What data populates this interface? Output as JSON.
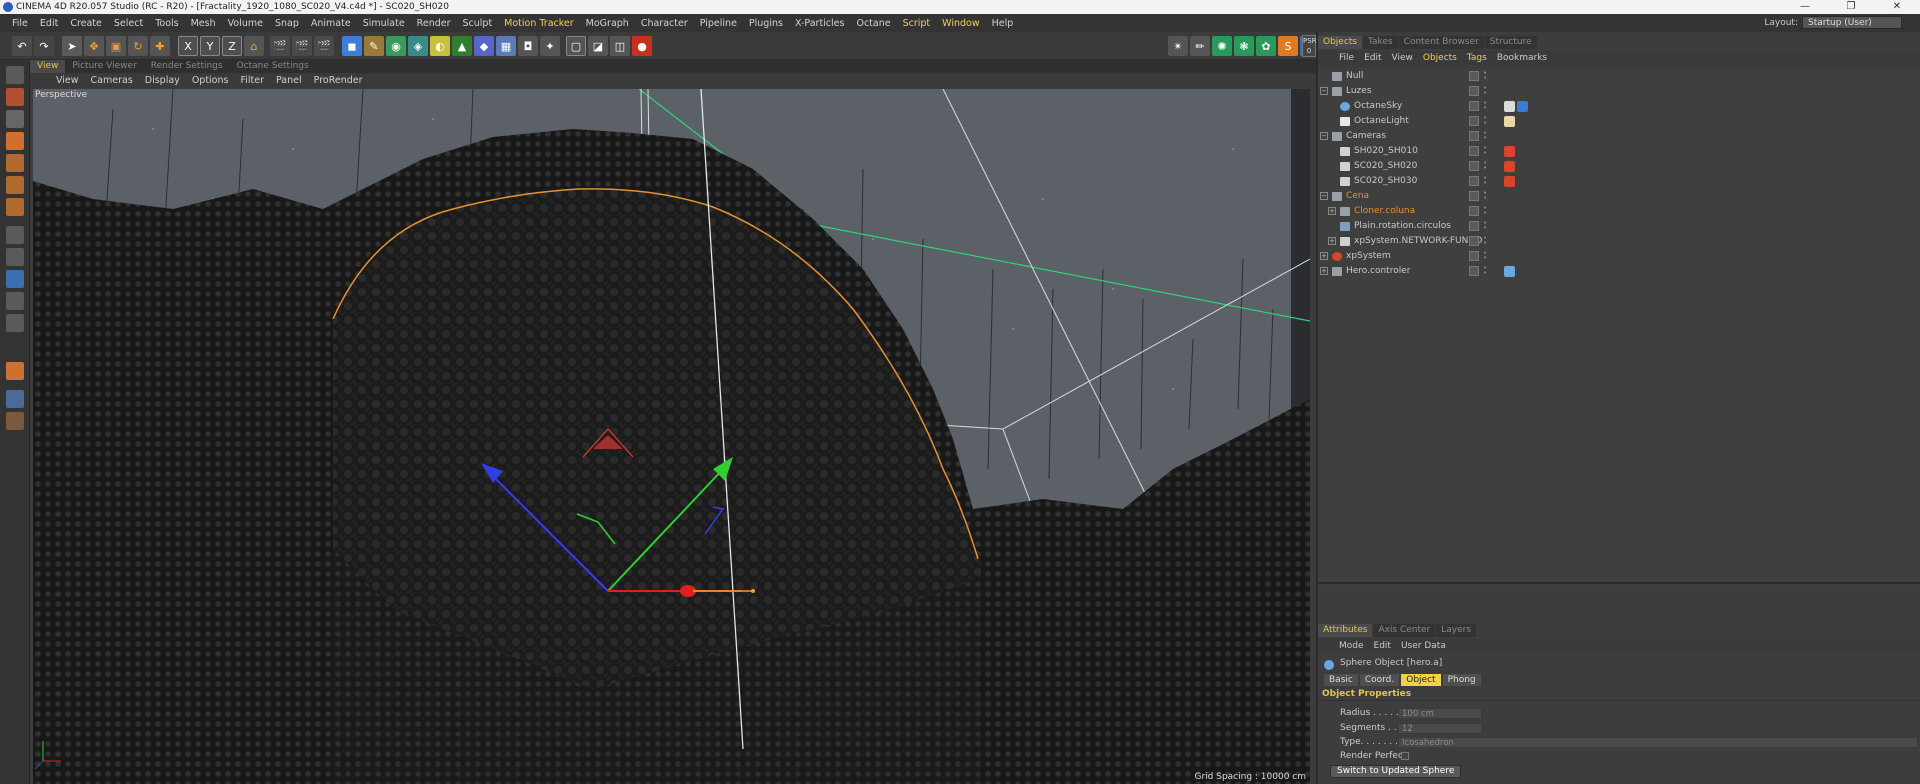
{
  "window": {
    "title": "CINEMA 4D R20.057 Studio (RC - R20) - [Fractality_1920_1080_SC020_V4.c4d *] - SC020_SH020",
    "controls": [
      "—",
      "❐",
      "✕"
    ]
  },
  "menubar": {
    "items": [
      {
        "label": "File",
        "hl": false
      },
      {
        "label": "Edit",
        "hl": false
      },
      {
        "label": "Create",
        "hl": false
      },
      {
        "label": "Select",
        "hl": false
      },
      {
        "label": "Tools",
        "hl": false
      },
      {
        "label": "Mesh",
        "hl": false
      },
      {
        "label": "Volume",
        "hl": false
      },
      {
        "label": "Snap",
        "hl": false
      },
      {
        "label": "Animate",
        "hl": false
      },
      {
        "label": "Simulate",
        "hl": false
      },
      {
        "label": "Render",
        "hl": false
      },
      {
        "label": "Sculpt",
        "hl": false
      },
      {
        "label": "Motion Tracker",
        "hl": true
      },
      {
        "label": "MoGraph",
        "hl": false
      },
      {
        "label": "Character",
        "hl": false
      },
      {
        "label": "Pipeline",
        "hl": false
      },
      {
        "label": "Plugins",
        "hl": false
      },
      {
        "label": "X-Particles",
        "hl": false
      },
      {
        "label": "Octane",
        "hl": false
      },
      {
        "label": "Script",
        "hl": true
      },
      {
        "label": "Window",
        "hl": true
      },
      {
        "label": "Help",
        "hl": false
      }
    ],
    "layout_label": "Layout:",
    "layout_value": "Startup (User)"
  },
  "toolbar": {
    "axis_x": "X",
    "axis_y": "Y",
    "axis_z": "Z",
    "psr_label": "PSR",
    "psr_value": "0"
  },
  "viewport_tabs": [
    "View",
    "Picture Viewer",
    "Render Settings",
    "Octane Settings"
  ],
  "viewport_menu": [
    "View",
    "Cameras",
    "Display",
    "Options",
    "Filter",
    "Panel",
    "ProRender"
  ],
  "viewport": {
    "label": "Perspective",
    "grid_spacing": "Grid Spacing : 10000 cm"
  },
  "object_manager": {
    "tabs": [
      "Objects",
      "Takes",
      "Content Browser",
      "Structure"
    ],
    "menu": [
      "File",
      "Edit",
      "View",
      "Objects",
      "Tags",
      "Bookmarks"
    ],
    "rows": [
      {
        "name": "Null",
        "indent": 0,
        "icon": "null-icon",
        "color": "#bfbfbf",
        "orange": false,
        "expand": "",
        "tags": []
      },
      {
        "name": "Luzes",
        "indent": 0,
        "icon": "null-icon",
        "color": "#bfbfbf",
        "orange": false,
        "expand": "−",
        "tags": []
      },
      {
        "name": "OctaneSky",
        "indent": 1,
        "icon": "sky-icon",
        "color": "#bfbfbf",
        "orange": false,
        "expand": "",
        "tags": [
          "#dcdcdc",
          "#3a7bd5"
        ]
      },
      {
        "name": "OctaneLight",
        "indent": 1,
        "icon": "light-icon",
        "color": "#bfbfbf",
        "orange": false,
        "expand": "",
        "tags": [
          "#e8d9a8"
        ]
      },
      {
        "name": "Cameras",
        "indent": 0,
        "icon": "null-icon",
        "color": "#bfbfbf",
        "orange": false,
        "expand": "−",
        "tags": []
      },
      {
        "name": "SH020_SH010",
        "indent": 1,
        "icon": "camera-icon",
        "color": "#bfbfbf",
        "orange": false,
        "expand": "",
        "tags": [
          "#d9452b"
        ]
      },
      {
        "name": "SC020_SH020",
        "indent": 1,
        "icon": "camera-icon",
        "color": "#bfbfbf",
        "orange": false,
        "expand": "",
        "tags": [
          "#d9452b"
        ]
      },
      {
        "name": "SC020_SH030",
        "indent": 1,
        "icon": "camera-icon",
        "color": "#bfbfbf",
        "orange": false,
        "expand": "",
        "tags": [
          "#d9452b"
        ]
      },
      {
        "name": "Cena",
        "indent": 0,
        "icon": "null-icon",
        "color": "#e6912e",
        "orange": true,
        "expand": "−",
        "tags": []
      },
      {
        "name": "Cloner.coluna",
        "indent": 1,
        "icon": "null-icon",
        "color": "#e6912e",
        "orange": true,
        "expand": "+",
        "tags": []
      },
      {
        "name": "Plain.rotation.circulos",
        "indent": 1,
        "icon": "plain-icon",
        "color": "#bfbfbf",
        "orange": false,
        "expand": "",
        "tags": []
      },
      {
        "name": "xpSystem.NETWORK-FUNDO",
        "indent": 1,
        "icon": "xp-icon",
        "color": "#bfbfbf",
        "orange": false,
        "expand": "+",
        "tags": []
      },
      {
        "name": "xpSystem",
        "indent": 0,
        "icon": "xp-red-icon",
        "color": "#bfbfbf",
        "orange": false,
        "expand": "+",
        "tags": []
      },
      {
        "name": "Hero.controler",
        "indent": 0,
        "icon": "null-icon",
        "color": "#bfbfbf",
        "orange": false,
        "expand": "+",
        "tags": [
          "#6aa8e0"
        ]
      }
    ]
  },
  "attributes": {
    "tabs": [
      "Attributes",
      "Axis Center",
      "Layers"
    ],
    "menu": [
      "Mode",
      "Edit",
      "User Data"
    ],
    "object_title": "Sphere Object [hero.a]",
    "subtabs": [
      {
        "label": "Basic",
        "active": false
      },
      {
        "label": "Coord.",
        "active": false
      },
      {
        "label": "Object",
        "active": true
      },
      {
        "label": "Phong",
        "active": false
      }
    ],
    "section": "Object Properties",
    "radius_label": "Radius . . . . .",
    "radius_value": "100 cm",
    "segments_label": "Segments . . .",
    "segments_value": "12",
    "type_label": "Type. . . . . . . . .",
    "type_value": "Icosahedron",
    "render_perfect_label": "Render Perfect",
    "switch_button": "Switch to Updated Sphere"
  },
  "colors": {
    "accent": "#f0d24a",
    "orange": "#e6912e",
    "axis_x": "#e02020",
    "axis_y": "#2fd02f",
    "axis_z": "#3040e0"
  }
}
